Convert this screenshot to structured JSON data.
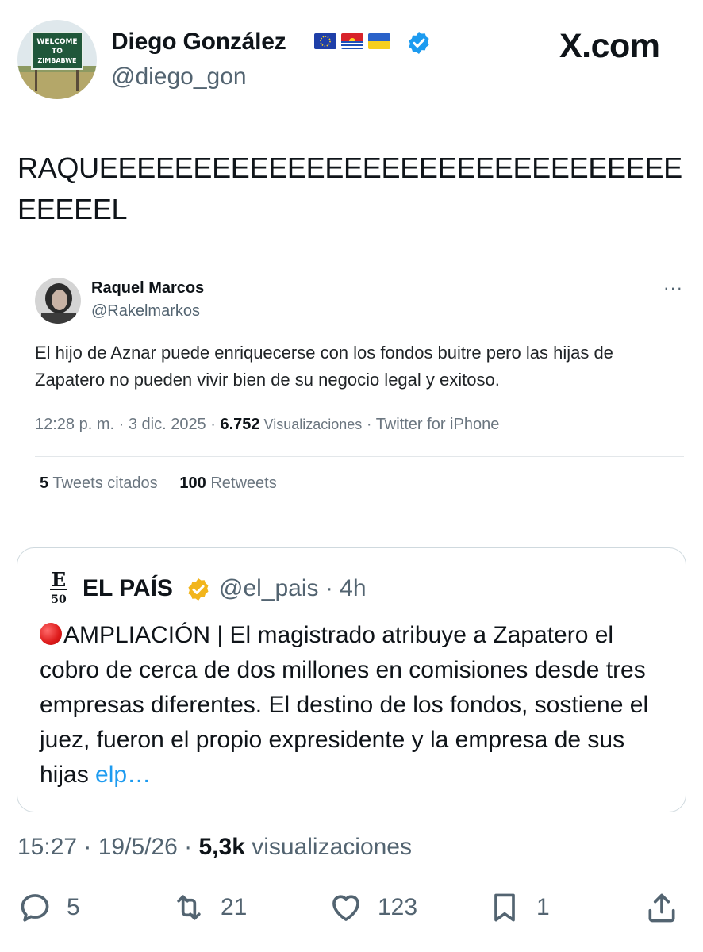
{
  "author": {
    "name": "Diego González",
    "handle": "@diego_gon",
    "avatar_sign_text": [
      "WELCOME",
      "TO",
      "ZIMBABWE"
    ],
    "flags": [
      "eu-flag-icon",
      "kiribati-flag-icon",
      "ukraine-flag-icon"
    ],
    "verified_color": "#1d9bf0"
  },
  "brand": {
    "logo_text": "X.com"
  },
  "tweet": {
    "text": "RAQUEEEEEEEEEEEEEEEEEEEEEEEEEEEEEEEEEEEEL"
  },
  "embedded": {
    "name": "Raquel Marcos",
    "handle": "@Rakelmarkos",
    "text": "El hijo de Aznar puede enriquecerse con los fondos buitre pero las hijas de Zapatero no pueden vivir bien de su negocio legal y exitoso.",
    "time": "12:28 p. m. · 3 dic. 2025 · ",
    "views": "6.752",
    "views_label": " Visualizaciones",
    "source": " · Twitter for iPhone",
    "quotes_count": "5",
    "quotes_label": "Tweets citados",
    "retweets_count": "100",
    "retweets_label": "Retweets",
    "more": "···"
  },
  "quote_card": {
    "name": "EL PAÍS",
    "handle": "@el_pais · 4h",
    "logo_letter": "E",
    "logo_number": "50",
    "verified_color": "#f2b51c",
    "text": "AMPLIACIÓN | El magistrado atribuye a Zapatero el cobro de cerca de dos millones en comisiones desde tres empresas diferentes. El destino de los fondos, sostiene el juez, fueron el propio expresidente y la empresa de sus hijas ",
    "link": "elp…"
  },
  "meta": {
    "time": "15:27 · 19/5/26 · ",
    "views": "5,3k",
    "views_label": " visualizaciones"
  },
  "actions": {
    "replies": "5",
    "reposts": "21",
    "likes": "123",
    "bookmarks": "1"
  },
  "colors": {
    "text": "#0f1419",
    "secondary": "#536471",
    "link": "#1d9bf0",
    "border": "#cfd9de"
  }
}
